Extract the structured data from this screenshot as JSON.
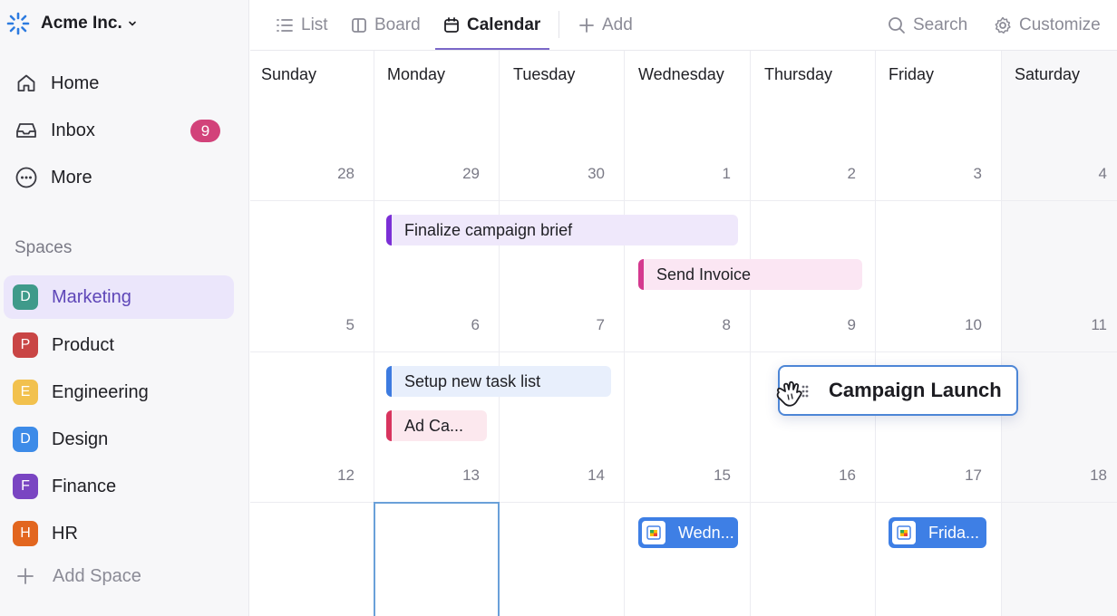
{
  "workspace": {
    "name": "Acme Inc."
  },
  "nav": [
    {
      "label": "Home",
      "icon": "home-icon"
    },
    {
      "label": "Inbox",
      "icon": "inbox-icon",
      "badge": "9"
    },
    {
      "label": "More",
      "icon": "more-icon"
    }
  ],
  "spaces": {
    "title": "Spaces",
    "items": [
      {
        "letter": "D",
        "label": "Marketing",
        "color": "#3f9a8a",
        "active": true
      },
      {
        "letter": "P",
        "label": "Product",
        "color": "#c94545"
      },
      {
        "letter": "E",
        "label": "Engineering",
        "color": "#f2c14e"
      },
      {
        "letter": "D",
        "label": "Design",
        "color": "#3d8be8"
      },
      {
        "letter": "F",
        "label": "Finance",
        "color": "#7a45c2"
      },
      {
        "letter": "H",
        "label": "HR",
        "color": "#e2661f"
      }
    ],
    "add_label": "Add Space"
  },
  "toolbar": {
    "tabs": [
      {
        "label": "List",
        "icon": "list-icon"
      },
      {
        "label": "Board",
        "icon": "board-icon"
      },
      {
        "label": "Calendar",
        "icon": "calendar-icon",
        "active": true
      }
    ],
    "add_label": "Add",
    "search_label": "Search",
    "customize_label": "Customize"
  },
  "calendar": {
    "days": [
      "Sunday",
      "Monday",
      "Tuesday",
      "Wednesday",
      "Thursday",
      "Friday",
      "Saturday"
    ],
    "weeks": [
      [
        "28",
        "29",
        "30",
        "1",
        "2",
        "3",
        "4"
      ],
      [
        "5",
        "6",
        "7",
        "8",
        "9",
        "10",
        "11"
      ],
      [
        "12",
        "13",
        "14",
        "15",
        "16",
        "17",
        "18"
      ]
    ],
    "events": [
      {
        "title": "Finalize campaign brief",
        "color": "#7b2fd6",
        "bg": "#efe8fb"
      },
      {
        "title": "Send Invoice",
        "color": "#d4398f",
        "bg": "#fbe6f3"
      },
      {
        "title": "Setup new task list",
        "color": "#3d7be0",
        "bg": "#e8effc"
      },
      {
        "title": "Ad Ca...",
        "color": "#d8345e",
        "bg": "#fce8ee"
      },
      {
        "title": "Wedn...",
        "color": "#3e7fe5"
      },
      {
        "title": "Frida...",
        "color": "#3e7fe5"
      }
    ],
    "dragging_event": {
      "title": "Campaign Launch"
    }
  }
}
